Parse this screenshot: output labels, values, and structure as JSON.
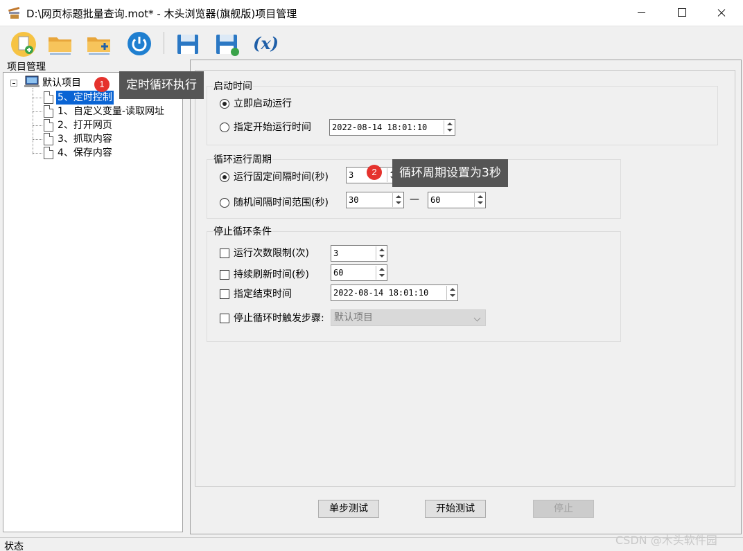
{
  "window": {
    "title": "D:\\网页标题批量查询.mot* - 木头浏览器(旗舰版)项目管理"
  },
  "toolbar": {
    "buttons": [
      {
        "icon": "new-file-icon"
      },
      {
        "icon": "open-folder-icon"
      },
      {
        "icon": "add-folder-icon"
      },
      {
        "icon": "power-icon"
      },
      {
        "icon": "save-icon"
      },
      {
        "icon": "save-as-icon"
      },
      {
        "icon": "variable-icon",
        "label": "(x)"
      }
    ]
  },
  "project_panel": {
    "title": "项目管理",
    "root": "默认项目",
    "items": [
      "5、定时控制",
      "1、自定义变量-读取网址",
      "2、打开网页",
      "3、抓取内容",
      "4、保存内容"
    ],
    "selected_index": 0
  },
  "start_group": {
    "legend": "启动时间",
    "opt_immediate": "立即启动运行",
    "opt_specified": "指定开始运行时间",
    "start_time": "2022-08-14 18:01:10",
    "selected": "immediate"
  },
  "cycle_group": {
    "legend": "循环运行周期",
    "opt_fixed": "运行固定间隔时间(秒)",
    "fixed_value": "3",
    "opt_random": "随机间隔时间范围(秒)",
    "random_min": "30",
    "dash": "—",
    "random_max": "60",
    "selected": "fixed"
  },
  "stop_group": {
    "legend": "停止循环条件",
    "opt_run_limit": "运行次数限制(次)",
    "run_limit_value": "3",
    "opt_refresh": "持续刷新时间(秒)",
    "refresh_value": "60",
    "opt_end_time": "指定结束时间",
    "end_time": "2022-08-14 18:01:10",
    "opt_trigger": "停止循环时触发步骤:",
    "trigger_value": "默认项目"
  },
  "buttons": {
    "step_test": "单步测试",
    "start_test": "开始测试",
    "stop": "停止"
  },
  "annotations": [
    {
      "number": "1",
      "text": "定时循环执行"
    },
    {
      "number": "2",
      "text": "循环周期设置为3秒"
    }
  ],
  "status": {
    "label": "状态"
  },
  "watermark": "CSDN @木头软件园",
  "colors": {
    "selection": "#0a64d4",
    "badge": "#e5322d",
    "callout": "#555555",
    "power": "#1f7fd0"
  }
}
